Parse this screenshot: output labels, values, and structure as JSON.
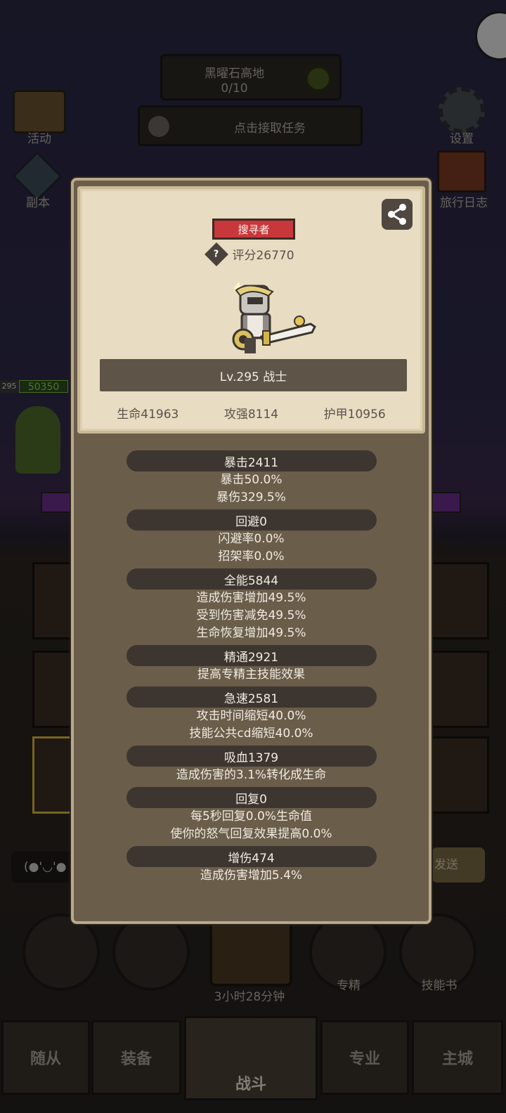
{
  "background": {
    "zone_name": "黑曜石高地",
    "zone_progress": "0/10",
    "quest_prompt": "点击接取任务",
    "left_menu": [
      "活动",
      "副本"
    ],
    "right_menu": [
      "设置",
      "旅行日志"
    ],
    "player_level": "295",
    "player_power": "50350",
    "chat_preview": "(●'◡'●",
    "send_label": "发送",
    "bottom_actions": [
      "专精",
      "技能书"
    ],
    "chest_timer": "3小时28分钟",
    "tabs": [
      "随从",
      "装备",
      "战斗",
      "专业",
      "主城"
    ]
  },
  "card": {
    "badge": "搜寻者",
    "rating": "评分26770",
    "level_class": "Lv.295 战士",
    "stats": [
      "生命41963",
      "攻强8114",
      "护甲10956"
    ]
  },
  "stat_groups": [
    {
      "header": "暴击2411",
      "lines": [
        "暴击50.0%",
        "暴伤329.5%"
      ]
    },
    {
      "header": "回避0",
      "lines": [
        "闪避率0.0%",
        "招架率0.0%"
      ]
    },
    {
      "header": "全能5844",
      "lines": [
        "造成伤害增加49.5%",
        "受到伤害减免49.5%",
        "生命恢复增加49.5%"
      ]
    },
    {
      "header": "精通2921",
      "lines": [
        "提高专精主技能效果"
      ]
    },
    {
      "header": "急速2581",
      "lines": [
        "攻击时间缩短40.0%",
        "技能公共cd缩短40.0%"
      ]
    },
    {
      "header": "吸血1379",
      "lines": [
        "造成伤害的3.1%转化成生命"
      ]
    },
    {
      "header": "回复0",
      "lines": [
        "每5秒回复0.0%生命值",
        "使你的怒气回复效果提高0.0%"
      ]
    },
    {
      "header": "增伤474",
      "lines": [
        "造成伤害增加5.4%"
      ]
    }
  ],
  "colors": {
    "badge": "#c8383b",
    "modal_bg": "#6a5d4a",
    "card_bg": "#e8dcc2",
    "accent_green": "#7ac943"
  }
}
